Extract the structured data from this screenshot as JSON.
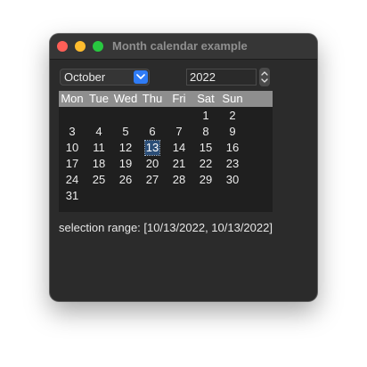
{
  "window": {
    "title": "Month calendar example"
  },
  "month_select": {
    "value": "October"
  },
  "year_spinbox": {
    "value": "2022"
  },
  "calendar": {
    "weekday_headers": [
      "Mon",
      "Tue",
      "Wed",
      "Thu",
      "Fri",
      "Sat",
      "Sun"
    ],
    "weeks": [
      [
        "",
        "",
        "",
        "",
        "",
        "1",
        "2"
      ],
      [
        "3",
        "4",
        "5",
        "6",
        "7",
        "8",
        "9"
      ],
      [
        "10",
        "11",
        "12",
        "13",
        "14",
        "15",
        "16"
      ],
      [
        "17",
        "18",
        "19",
        "20",
        "21",
        "22",
        "23"
      ],
      [
        "24",
        "25",
        "26",
        "27",
        "28",
        "29",
        "30"
      ],
      [
        "31",
        "",
        "",
        "",
        "",
        "",
        ""
      ]
    ],
    "selected_day": "13"
  },
  "status": {
    "selection_text": "selection range: [10/13/2022, 10/13/2022]"
  },
  "colors": {
    "window_bg": "#2b2b2b",
    "header_bg": "#8e8e8e",
    "calendar_bg": "#1f1f1f",
    "selection_bg": "#2b4e78",
    "accent": "#2f7cf6"
  }
}
